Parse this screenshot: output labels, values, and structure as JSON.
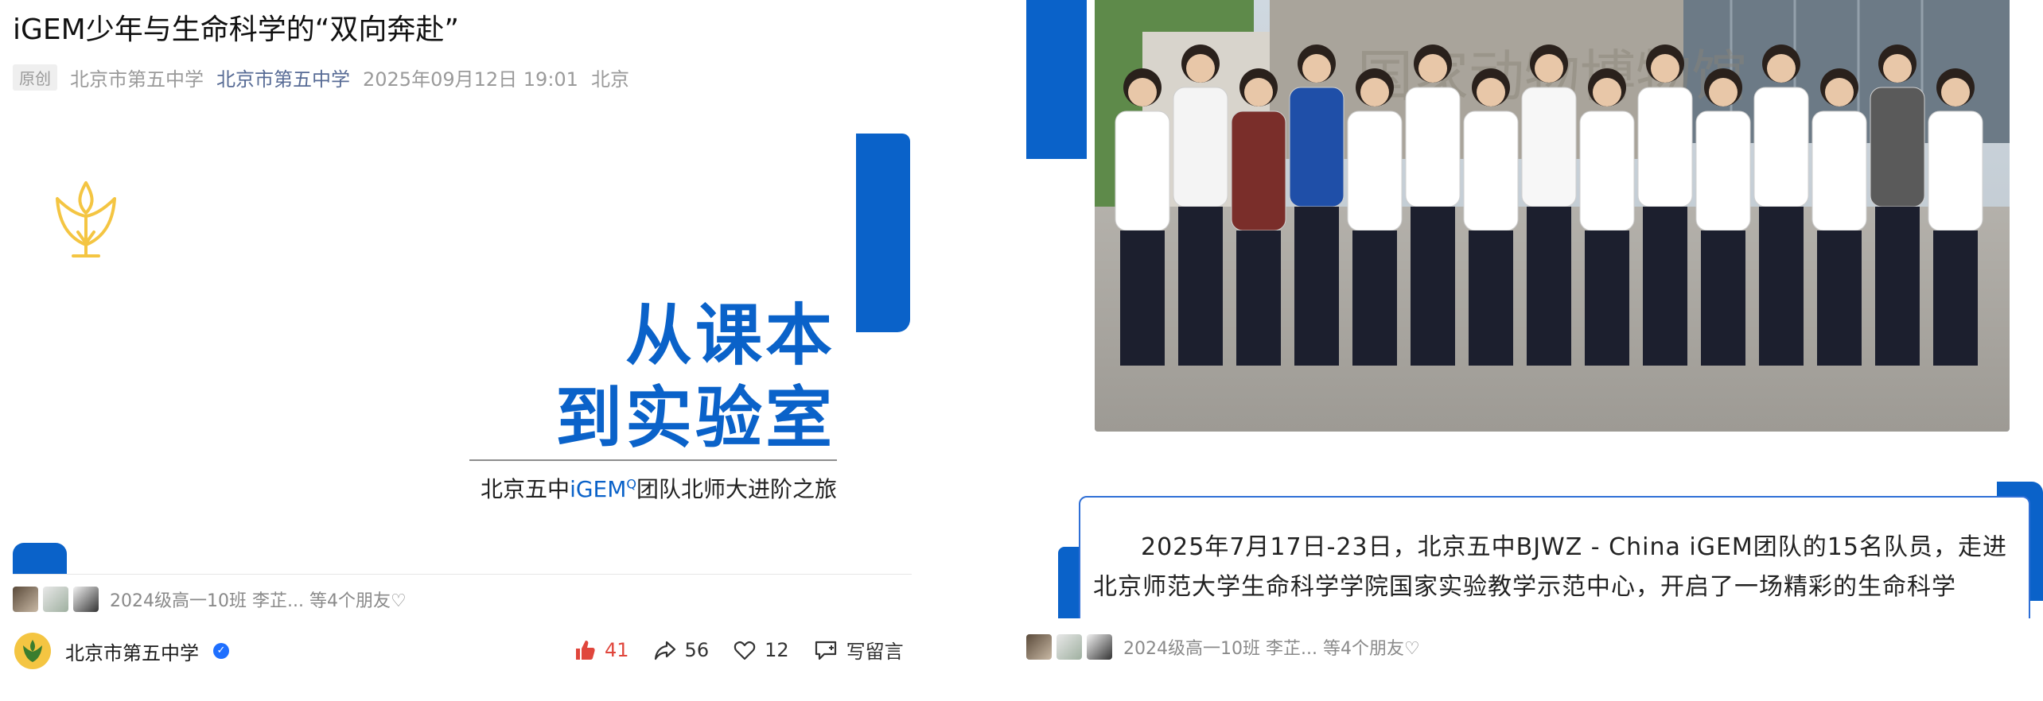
{
  "left": {
    "title": "iGEM少年与生命科学的“双向奔赴”",
    "meta": {
      "tag": "原创",
      "author": "北京市第五中学",
      "account": "北京市第五中学",
      "date": "2025年09月12日 19:01",
      "location": "北京"
    },
    "banner": {
      "headline_line1": "从课本",
      "headline_line2": "到实验室",
      "sub_prefix": "北京五中",
      "sub_accent": "iGEM",
      "sub_mark": "Q",
      "sub_suffix": "团队北师大进阶之旅",
      "accent_color": "#0a62c9",
      "logo_color": "#f4c542"
    },
    "friends": {
      "text": "2024级高一10班 李芷... 等4个朋友♡"
    },
    "account_row": {
      "name": "北京市第五中学"
    },
    "actions": {
      "like_count": "41",
      "share_count": "56",
      "fav_count": "12",
      "comment_label": "写留言"
    }
  },
  "right": {
    "photo_alt": "group-photo",
    "callout_text": "2025年7月17日-23日，北京五中BJWZ - China iGEM团队的15名队员，走进北京师范大学生命科学学院国家实验教学示范中心，开启了一场精彩的生命科学",
    "friends": {
      "text": "2024级高一10班 李芷... 等4个朋友♡"
    }
  }
}
